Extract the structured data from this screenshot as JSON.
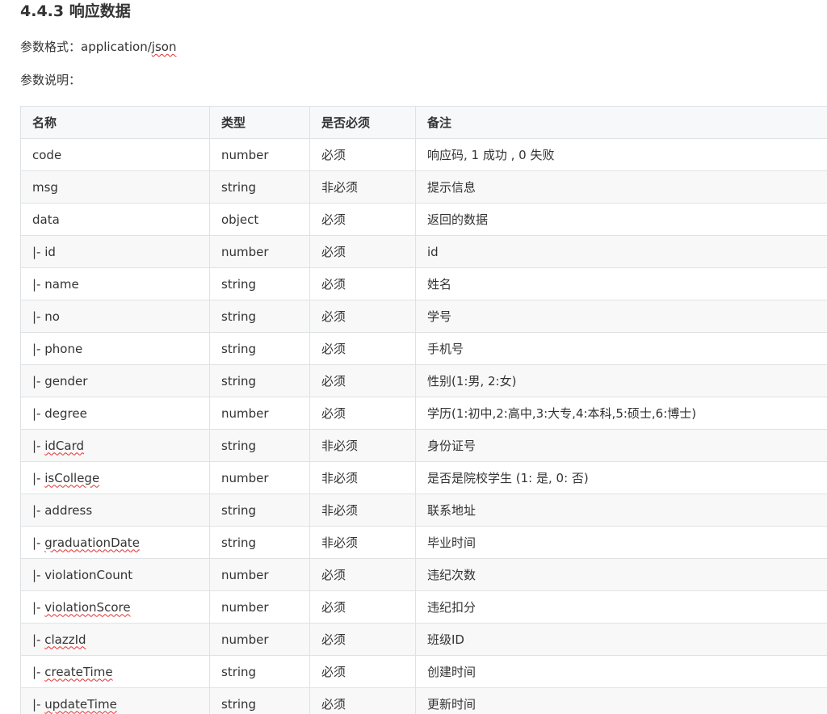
{
  "heading": "4.4.3 响应数据",
  "format": {
    "prefix": "参数格式：application/",
    "squiggle": "json"
  },
  "desc_label": "参数说明：",
  "table": {
    "headers": [
      "名称",
      "类型",
      "是否必须",
      "备注"
    ],
    "rows": [
      {
        "name": "code",
        "squiggle": false,
        "type": "number",
        "required": "必须",
        "note": "响应码, 1 成功 , 0 失败"
      },
      {
        "name": "msg",
        "squiggle": false,
        "type": "string",
        "required": "非必须",
        "note": "提示信息"
      },
      {
        "name": "data",
        "squiggle": false,
        "type": "object",
        "required": "必须",
        "note": "返回的数据"
      },
      {
        "name": "|- id",
        "squiggle": false,
        "type": "number",
        "required": "必须",
        "note": "id"
      },
      {
        "name": "|- name",
        "squiggle": false,
        "type": "string",
        "required": "必须",
        "note": "姓名"
      },
      {
        "name": "|- no",
        "squiggle": false,
        "type": "string",
        "required": "必须",
        "note": "学号"
      },
      {
        "name": "|- phone",
        "squiggle": false,
        "type": "string",
        "required": "必须",
        "note": "手机号"
      },
      {
        "name": "|- gender",
        "squiggle": false,
        "type": "string",
        "required": "必须",
        "note": "性别(1:男, 2:女)"
      },
      {
        "name": "|- degree",
        "squiggle": false,
        "type": "number",
        "required": "必须",
        "note": "学历(1:初中,2:高中,3:大专,4:本科,5:硕士,6:博士)"
      },
      {
        "name": "|- idCard",
        "squiggle": true,
        "type": "string",
        "required": "非必须",
        "note": "身份证号"
      },
      {
        "name": "|- isCollege",
        "squiggle": true,
        "type": "number",
        "required": "非必须",
        "note": "是否是院校学生 (1: 是, 0: 否)"
      },
      {
        "name": "|- address",
        "squiggle": false,
        "type": "string",
        "required": "非必须",
        "note": "联系地址"
      },
      {
        "name": "|- graduationDate",
        "squiggle": true,
        "type": "string",
        "required": "非必须",
        "note": "毕业时间"
      },
      {
        "name": "|- violationCount",
        "squiggle": false,
        "type": "number",
        "required": "必须",
        "note": "违纪次数"
      },
      {
        "name": "|- violationScore",
        "squiggle": true,
        "type": "number",
        "required": "必须",
        "note": "违纪扣分"
      },
      {
        "name": "|- clazzId",
        "squiggle": true,
        "type": "number",
        "required": "必须",
        "note": "班级ID"
      },
      {
        "name": "|- createTime",
        "squiggle": true,
        "type": "string",
        "required": "必须",
        "note": "创建时间"
      },
      {
        "name": "|- updateTime",
        "squiggle": true,
        "type": "string",
        "required": "必须",
        "note": "更新时间"
      }
    ]
  },
  "colors": {
    "text": "#333333",
    "border": "#dfe2e5",
    "header_bg": "#f6f8fa",
    "stripe_bg": "#f8f8f8",
    "spellcheck": "#e03030"
  }
}
